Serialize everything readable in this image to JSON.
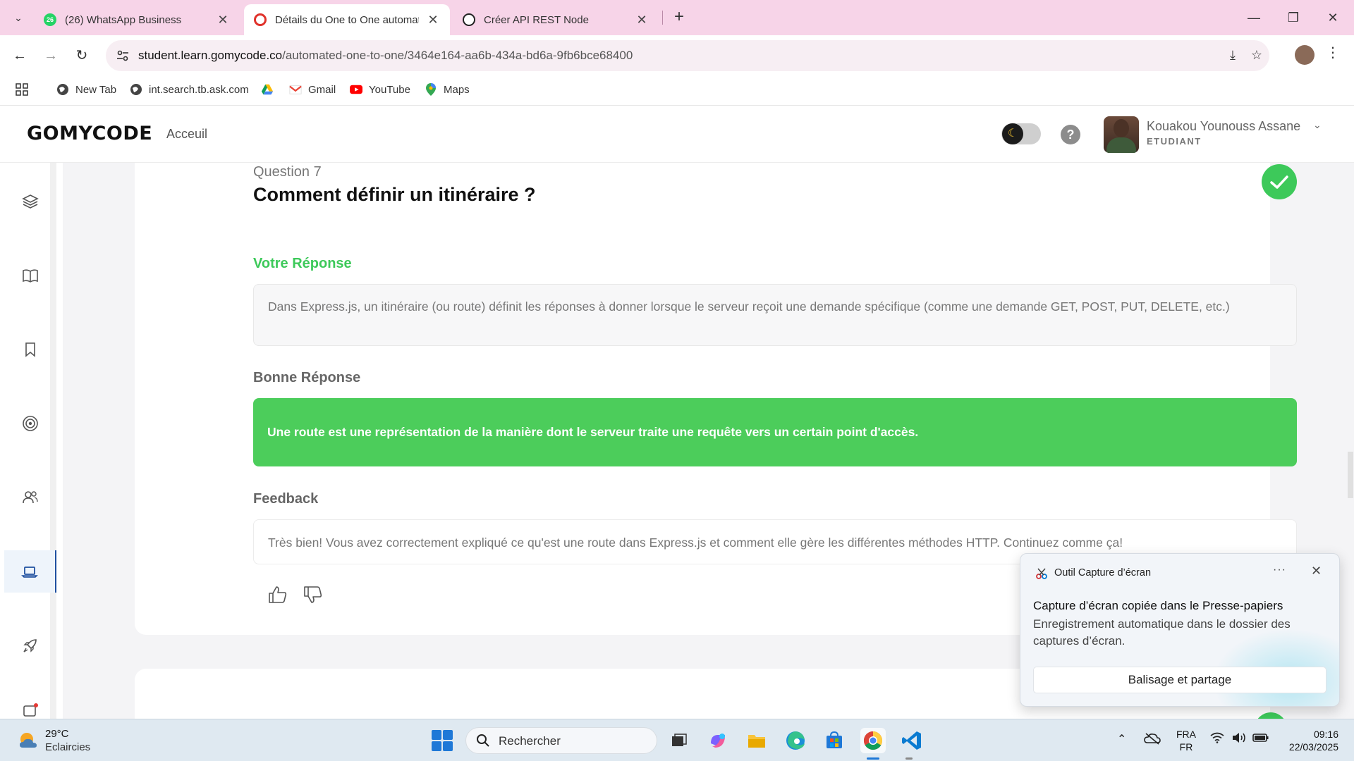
{
  "browser": {
    "tabs": [
      {
        "title": "(26) WhatsApp Business",
        "badge": "26",
        "active": false
      },
      {
        "title": "Détails du One to One automatisé",
        "active": true
      },
      {
        "title": "Créer API REST Node",
        "active": false
      }
    ],
    "url_host": "student.learn.gomycode.co",
    "url_path": "/automated-one-to-one/3464e164-aa6b-434a-bd6a-9fb6bce68400",
    "bookmarks": [
      "New Tab",
      "int.search.tb.ask.com",
      "",
      "Gmail",
      "YouTube",
      "Maps"
    ]
  },
  "app": {
    "logo": "GOMYCODE",
    "nav_home": "Acceuil",
    "user_name": "Kouakou Younouss Assane",
    "user_role": "ETUDIANT",
    "help": "?"
  },
  "question": {
    "number_label": "Question 7",
    "title": "Comment définir un itinéraire ?",
    "your_answer_label": "Votre Réponse",
    "your_answer": "Dans Express.js, un itinéraire (ou route) définit les réponses à donner lorsque le serveur reçoit une demande spécifique (comme une demande GET, POST, PUT, DELETE, etc.)",
    "correct_label": "Bonne Réponse",
    "correct_answer": "Une route est une représentation de la manière dont le serveur traite une requête vers un certain point d'accès.",
    "feedback_label": "Feedback",
    "feedback": "Très bien! Vous avez correctement expliqué ce qu'est une route dans Express.js et comment elle gère les différentes méthodes HTTP. Continuez comme ça!"
  },
  "toast": {
    "app": "Outil Capture d’écran",
    "more": "···",
    "title": "Capture d’écran copiée dans le Presse-papiers",
    "body": "Enregistrement automatique dans le dossier des captures d’écran.",
    "button": "Balisage et partage"
  },
  "taskbar": {
    "temp": "29°C",
    "weather": "Eclaircies",
    "search": "Rechercher",
    "lang1": "FRA",
    "lang2": "FR",
    "time": "09:16",
    "date": "22/03/2025"
  },
  "colors": {
    "success": "#4ccd5b",
    "check": "#3dc95a",
    "tabstrip": "#f7d4e8"
  }
}
